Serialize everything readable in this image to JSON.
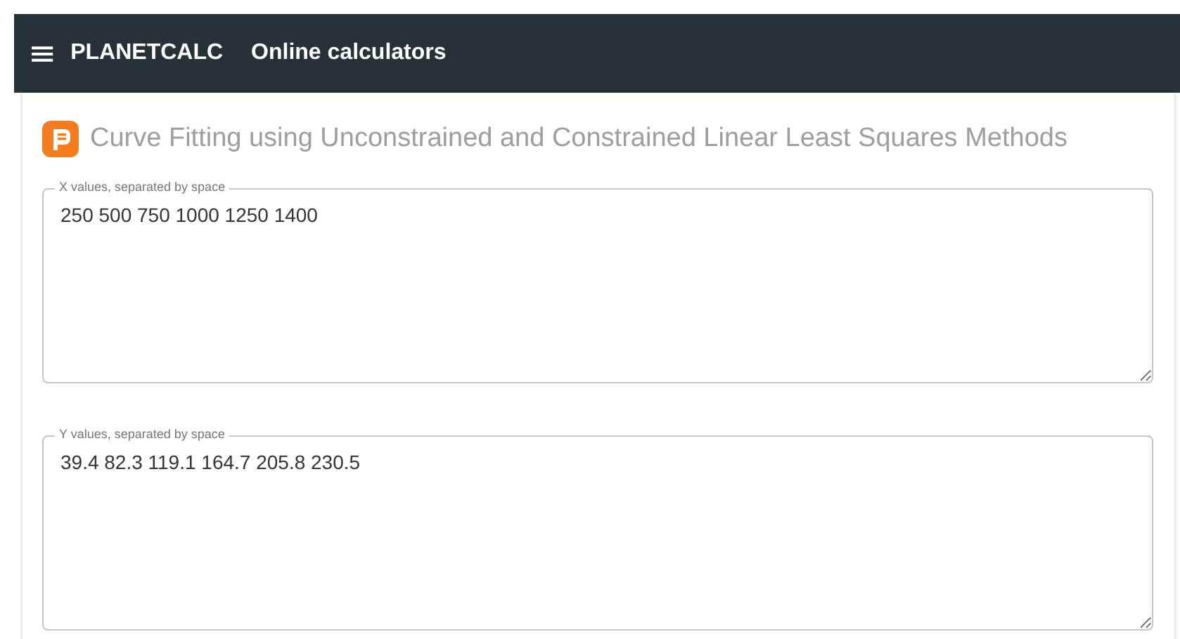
{
  "header": {
    "menu": "≡",
    "brand": "PLANETCALC",
    "title": "Online calculators"
  },
  "calculator": {
    "title": "Curve Fitting using Unconstrained and Constrained Linear Least Squares Methods",
    "fields": [
      {
        "label": "X values, separated by space",
        "value": "250 500 750 1000 1250 1400"
      },
      {
        "label": "Y values, separated by space",
        "value": "39.4 82.3 119.1 164.7 205.8 230.5"
      }
    ]
  }
}
